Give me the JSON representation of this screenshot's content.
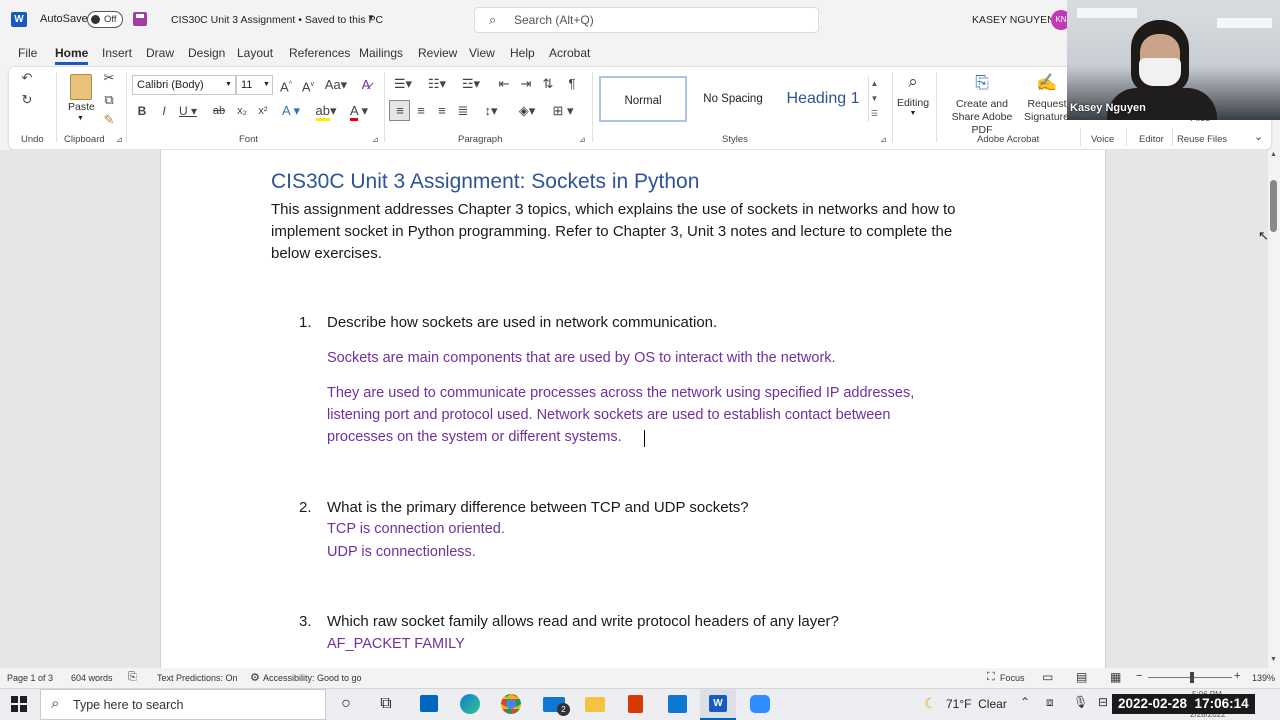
{
  "titlebar": {
    "autosave_label": "AutoSave",
    "autosave_state": "Off",
    "doc_title": "CIS30C Unit 3 Assignment • Saved to this PC",
    "search_placeholder": "Search (Alt+Q)",
    "user_name": "KASEY NGUYEN",
    "user_initials": "KN"
  },
  "menu": [
    "File",
    "Home",
    "Insert",
    "Draw",
    "Design",
    "Layout",
    "References",
    "Mailings",
    "Review",
    "View",
    "Help",
    "Acrobat"
  ],
  "ribbon": {
    "undo_label": "Undo",
    "paste_label": "Paste",
    "clipboard_label": "Clipboard",
    "font_name": "Calibri (Body)",
    "font_size": "11",
    "font_label": "Font",
    "paragraph_label": "Paragraph",
    "styles": [
      "Normal",
      "No Spacing",
      "Heading 1"
    ],
    "styles_label": "Styles",
    "editing_label": "Editing",
    "create_share_pdf": "Create and Share Adobe PDF",
    "request_signatures": "Request Signatures",
    "adobe_label": "Adobe Acrobat",
    "voice_label": "Voice",
    "editor_label": "Editor",
    "reuse_files_label": "Reuse Files",
    "files_label": "Files"
  },
  "video": {
    "name": "Kasey Nguyen"
  },
  "document": {
    "title": "CIS30C Unit 3 Assignment: Sockets in Python",
    "intro_l1": "This assignment addresses Chapter 3 topics, which explains the use of sockets in networks and how to",
    "intro_l2": "implement socket in Python programming. Refer to Chapter 3, Unit 3 notes and lecture to complete the",
    "intro_l3": "below exercises.",
    "q1_num": "1.",
    "q1": "Describe how sockets are used in network communication.",
    "a1_p1": "Sockets are main components that are used by OS to interact with the network.",
    "a1_p2_l1": "They are used to communicate processes across the network using specified IP addresses,",
    "a1_p2_l2": "listening port and protocol used. Network sockets are used to establish contact between",
    "a1_p2_l3": "processes on the system or different systems.",
    "q2_num": "2.",
    "q2": "What is the primary difference between TCP and UDP sockets?",
    "a2_l1": "TCP is connection oriented.",
    "a2_l2": "UDP is connectionless.",
    "q3_num": "3.",
    "q3": "Which raw socket family allows read and write protocol headers of any layer?",
    "a3": "AF_PACKET FAMILY"
  },
  "status": {
    "page": "Page 1 of 3",
    "words": "604 words",
    "predictions": "Text Predictions: On",
    "accessibility": "Accessibility: Good to go",
    "focus": "Focus",
    "zoom": "139%"
  },
  "taskbar": {
    "search_placeholder": "Type here to search",
    "weather": "71°F  Clear",
    "datetime": "2022-02-28  17:06:14",
    "mail_badge": "2",
    "clock_small_1": "5:06 PM",
    "clock_small_2": "2/28/2022"
  },
  "colors": {
    "accent": "#185abd",
    "answer": "#7030a0",
    "heading": "#2f5496"
  }
}
